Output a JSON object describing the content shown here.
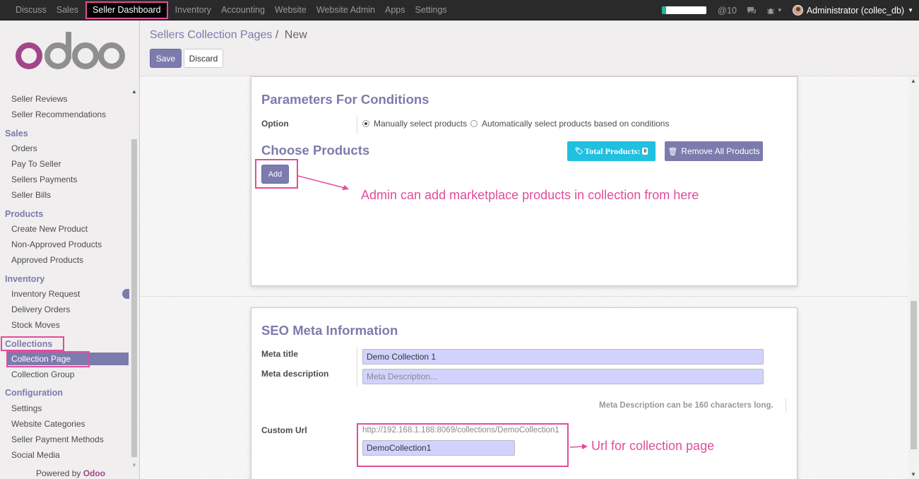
{
  "navbar": {
    "menu": [
      "Discuss",
      "Sales",
      "Seller Dashboard",
      "Inventory",
      "Accounting",
      "Website",
      "Website Admin",
      "Apps",
      "Settings"
    ],
    "active_index": 2,
    "progress_fraction": 0.1,
    "mentions_count": "10",
    "user": "Administrator (collec_db)"
  },
  "sidebar": {
    "logo_text": "odoo",
    "items_top": [
      "Seller Reviews",
      "Seller Recommendations"
    ],
    "sections": [
      {
        "title": "Sales",
        "items": [
          "Orders",
          "Pay To Seller",
          "Sellers Payments",
          "Seller Bills"
        ]
      },
      {
        "title": "Products",
        "items": [
          "Create New Product",
          "Non-Approved Products",
          "Approved Products"
        ]
      },
      {
        "title": "Inventory",
        "items": [
          "Inventory Request",
          "Delivery Orders",
          "Stock Moves"
        ]
      },
      {
        "title": "Collections",
        "items": [
          "Collection Page",
          "Collection Group"
        ]
      },
      {
        "title": "Configuration",
        "items": [
          "Settings",
          "Website Categories",
          "Seller Payment Methods",
          "Social Media"
        ]
      }
    ],
    "powered_by": "Powered by",
    "powered_brand": "Odoo"
  },
  "control": {
    "breadcrumb_parent": "Sellers Collection Pages",
    "breadcrumb_sep": "/",
    "breadcrumb_current": "New",
    "save_label": "Save",
    "discard_label": "Discard"
  },
  "conditions": {
    "title": "Parameters For Conditions",
    "option_label": "Option",
    "radio_manual": "Manually select products",
    "radio_auto": "Automatically select products based on conditions",
    "choose_title": "Choose Products",
    "total_label": "Total Products:",
    "total_count": "0",
    "remove_label": "Remove All Products",
    "add_label": "Add",
    "annotation": "Admin can add marketplace products in collection from here"
  },
  "seo": {
    "title": "SEO Meta Information",
    "meta_title_label": "Meta title",
    "meta_title_value": "Demo Collection 1",
    "meta_desc_label": "Meta description",
    "meta_desc_placeholder": "Meta Description...",
    "hint": "Meta Description can be 160 characters long.",
    "custom_url_label": "Custom Url",
    "url_preview": "http://192.168.1.188:8069/collections/DemoCollection1",
    "url_value": "DemoCollection1",
    "annotation": "Url for collection page"
  },
  "colors": {
    "accent": "#7c7bad",
    "highlight": "#e14d9b",
    "info": "#1fc0e0"
  }
}
